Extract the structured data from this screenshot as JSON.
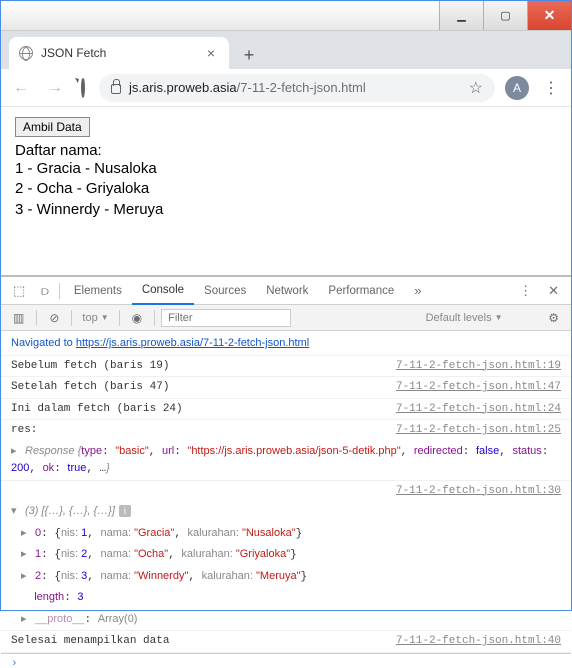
{
  "window": {
    "tab_title": "JSON Fetch",
    "avatar_letter": "A"
  },
  "url": {
    "host": "js.aris.proweb.asia",
    "path": "/7-11-2-fetch-json.html"
  },
  "page": {
    "button": "Ambil Data",
    "heading": "Daftar nama:",
    "list": [
      {
        "n": "1",
        "nama": "Gracia",
        "kal": "Nusaloka"
      },
      {
        "n": "2",
        "nama": "Ocha",
        "kal": "Griyaloka"
      },
      {
        "n": "3",
        "nama": "Winnerdy",
        "kal": "Meruya"
      }
    ]
  },
  "devtools": {
    "tabs": [
      "Elements",
      "Console",
      "Sources",
      "Network",
      "Performance"
    ],
    "context": "top",
    "filter_placeholder": "Filter",
    "levels": "Default levels",
    "lines": {
      "nav_label": "Navigated to ",
      "nav_url": "https://js.aris.proweb.asia/7-11-2-fetch-json.html",
      "l1": {
        "msg": "Sebelum fetch (baris 19)",
        "src": "7-11-2-fetch-json.html:19"
      },
      "l2": {
        "msg": "Setelah fetch (baris 47)",
        "src": "7-11-2-fetch-json.html:47"
      },
      "l3": {
        "msg": "Ini dalam fetch (baris 24)",
        "src": "7-11-2-fetch-json.html:24"
      },
      "l4": {
        "msg": "res:",
        "src": "7-11-2-fetch-json.html:25"
      },
      "resp": {
        "type": "basic",
        "url": "https://js.aris.proweb.asia/json-5-detik.php",
        "redirected": "false",
        "status": "200",
        "ok": "true"
      },
      "arr_src": "7-11-2-fetch-json.html:30",
      "arr_head": "(3) [{…}, {…}, {…}]",
      "arr": [
        {
          "i": "0",
          "nis": "1",
          "nama": "Gracia",
          "kal": "Nusaloka"
        },
        {
          "i": "1",
          "nis": "2",
          "nama": "Ocha",
          "kal": "Griyaloka"
        },
        {
          "i": "2",
          "nis": "3",
          "nama": "Winnerdy",
          "kal": "Meruya"
        }
      ],
      "length_label": "length",
      "length_val": "3",
      "proto_label": "__proto__",
      "proto_val": "Array(0)",
      "l_end": {
        "msg": "Selesai menampilkan data",
        "src": "7-11-2-fetch-json.html:40"
      }
    }
  }
}
